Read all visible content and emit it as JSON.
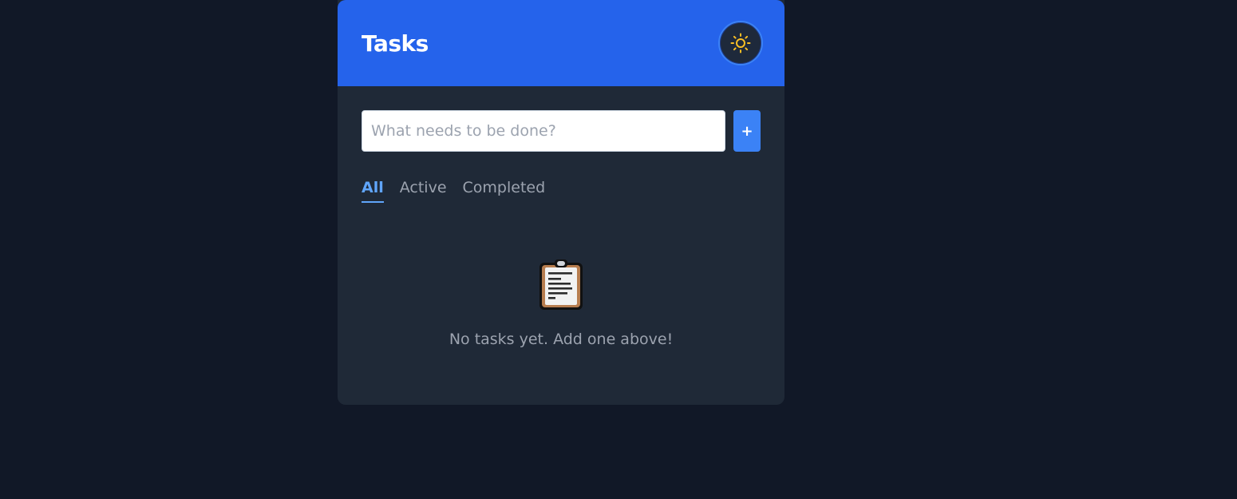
{
  "header": {
    "title": "Tasks",
    "theme_toggle_icon": "sun-icon",
    "brand_color": "#2563eb"
  },
  "add_task": {
    "placeholder": "What needs to be done?",
    "value": "",
    "add_label": "+"
  },
  "filters": {
    "tabs": [
      {
        "label": "All",
        "active": true
      },
      {
        "label": "Active",
        "active": false
      },
      {
        "label": "Completed",
        "active": false
      }
    ]
  },
  "empty_state": {
    "icon": "clipboard-icon",
    "message": "No tasks yet. Add one above!"
  }
}
